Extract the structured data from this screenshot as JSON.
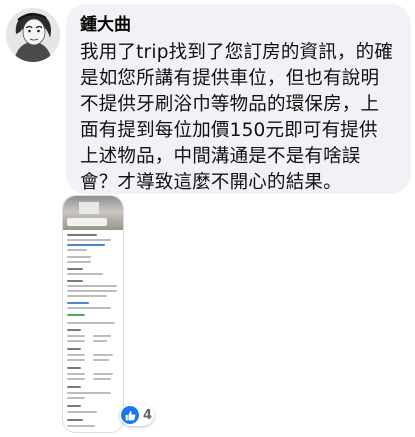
{
  "comment": {
    "author": "鍾大曲",
    "text_lines": [
      "我用了trip找到了您訂房的資訊，的確",
      "是如您所講有提供車位，但也有說明",
      "不提供牙刷浴巾等物品的環保房，上",
      "面有提到每位加價150元即可有提供",
      "上述物品，中間溝通是不是有啥誤",
      "會？才導致這麼不開心的結果。"
    ],
    "avatar_icon": "user-avatar-sketch-icon",
    "attachment_icon": "booking-screenshot-thumbnail",
    "reaction": {
      "icon": "like-icon",
      "color": "#1877f2",
      "count": "4"
    }
  }
}
